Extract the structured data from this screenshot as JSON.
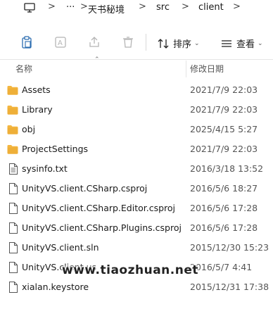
{
  "breadcrumb": {
    "more": "···",
    "items": [
      "天书秘境",
      "src",
      "client"
    ]
  },
  "toolbar": {
    "sort_label": "排序",
    "view_label": "查看"
  },
  "columns": {
    "name": "名称",
    "date": "修改日期"
  },
  "files": [
    {
      "name": "Assets",
      "date": "2021/7/9 22:03",
      "type": "folder"
    },
    {
      "name": "Library",
      "date": "2021/7/9 22:03",
      "type": "folder"
    },
    {
      "name": "obj",
      "date": "2025/4/15 5:27",
      "type": "folder"
    },
    {
      "name": "ProjectSettings",
      "date": "2021/7/9 22:03",
      "type": "folder"
    },
    {
      "name": "sysinfo.txt",
      "date": "2016/3/18 13:52",
      "type": "text"
    },
    {
      "name": "UnityVS.client.CSharp.csproj",
      "date": "2016/5/6 18:27",
      "type": "file"
    },
    {
      "name": "UnityVS.client.CSharp.Editor.csproj",
      "date": "2016/5/6 17:28",
      "type": "file"
    },
    {
      "name": "UnityVS.client.CSharp.Plugins.csproj",
      "date": "2016/5/6 17:28",
      "type": "file"
    },
    {
      "name": "UnityVS.client.sln",
      "date": "2015/12/30 15:23",
      "type": "file"
    },
    {
      "name": "UnityVS.client.us",
      "date": "2016/5/7 4:41",
      "type": "file"
    },
    {
      "name": "xialan.keystore",
      "date": "2015/12/31 17:38",
      "type": "file"
    }
  ],
  "watermark": "www.tiaozhuan.net",
  "colors": {
    "folder": "#f4b63f",
    "folder_dark": "#e3a32a",
    "accent": "#1a1a1a"
  }
}
